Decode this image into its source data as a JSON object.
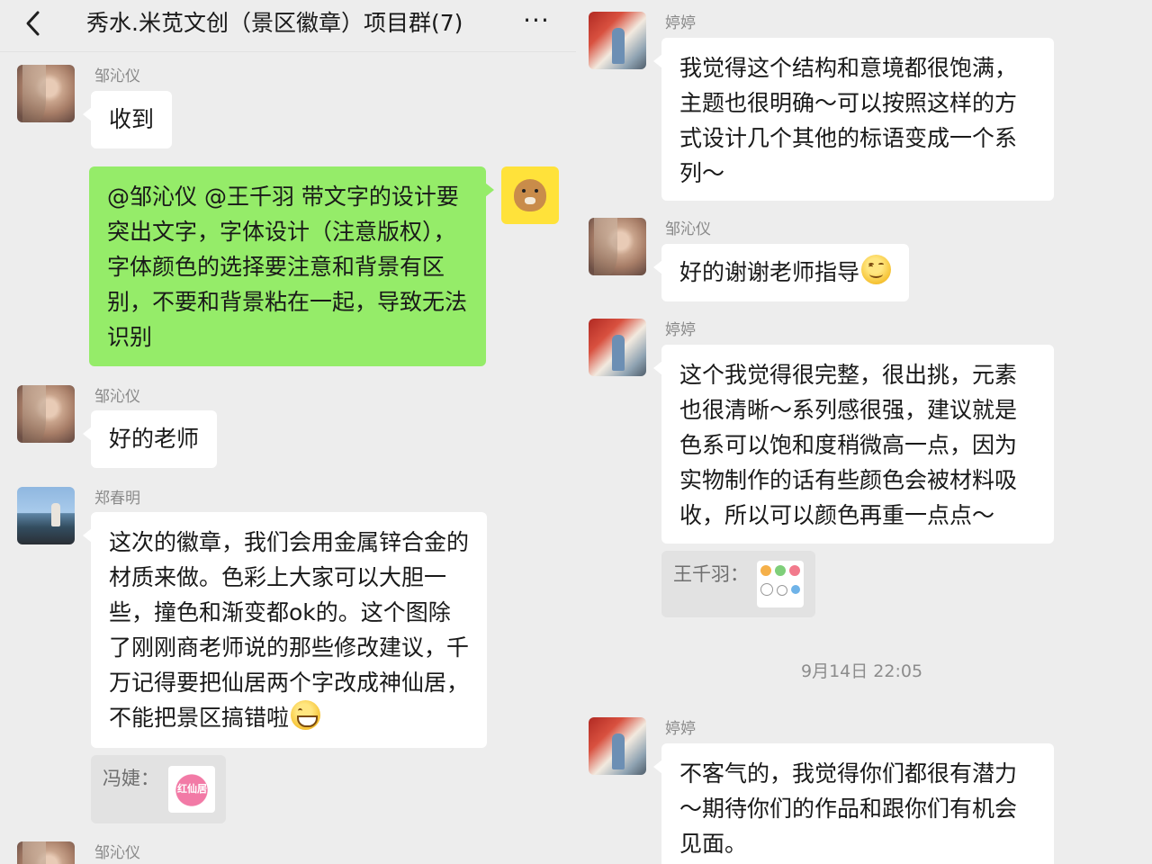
{
  "header": {
    "title": "秀水.米苋文创（景区徽章）项目群(7)",
    "more_label": "···"
  },
  "left": {
    "messages": [
      {
        "sender": "邹沁仪",
        "text": "收到"
      },
      {
        "text": "@邹沁仪  @王千羽  带文字的设计要突出文字，字体设计（注意版权），字体颜色的选择要注意和背景有区别，不要和背景粘在一起，导致无法识别"
      },
      {
        "sender": "邹沁仪",
        "text": "好的老师"
      },
      {
        "sender": "郑春明",
        "text": "这次的徽章，我们会用金属锌合金的材质来做。色彩上大家可以大胆一些，撞色和渐变都ok的。这个图除了刚刚商老师说的那些修改建议，千万记得要把仙居两个字改成神仙居，不能把景区搞错啦",
        "quote_label": "冯婕：",
        "quote_thumb_text": "红仙居"
      },
      {
        "sender": "邹沁仪"
      }
    ]
  },
  "right": {
    "messages": [
      {
        "sender": "婷婷",
        "text": "我觉得这个结构和意境都很饱满，主题也很明确～可以按照这样的方式设计几个其他的标语变成一个系列～"
      },
      {
        "sender": "邹沁仪",
        "text": "好的谢谢老师指导"
      },
      {
        "sender": "婷婷",
        "text": "这个我觉得很完整，很出挑，元素也很清晰～系列感很强，建议就是色系可以饱和度稍微高一点，因为实物制作的话有些颜色会被材料吸收，所以可以颜色再重一点点～",
        "quote_label": "王千羽："
      },
      {
        "sender": "婷婷",
        "text": "不客气的，我觉得你们都很有潜力～期待你们的作品和跟你们有机会见面。"
      }
    ],
    "timestamp": "9月14日 22:05"
  },
  "colors": {
    "background": "#ededed",
    "incoming_bubble": "#ffffff",
    "outgoing_bubble": "#95ec69",
    "quote_bg": "#e2e2e2",
    "sender_name": "#8a8a8a"
  },
  "icons": [
    "chevron-left-icon",
    "more-icon",
    "smile-emoji-icon",
    "grin-emoji-icon"
  ]
}
